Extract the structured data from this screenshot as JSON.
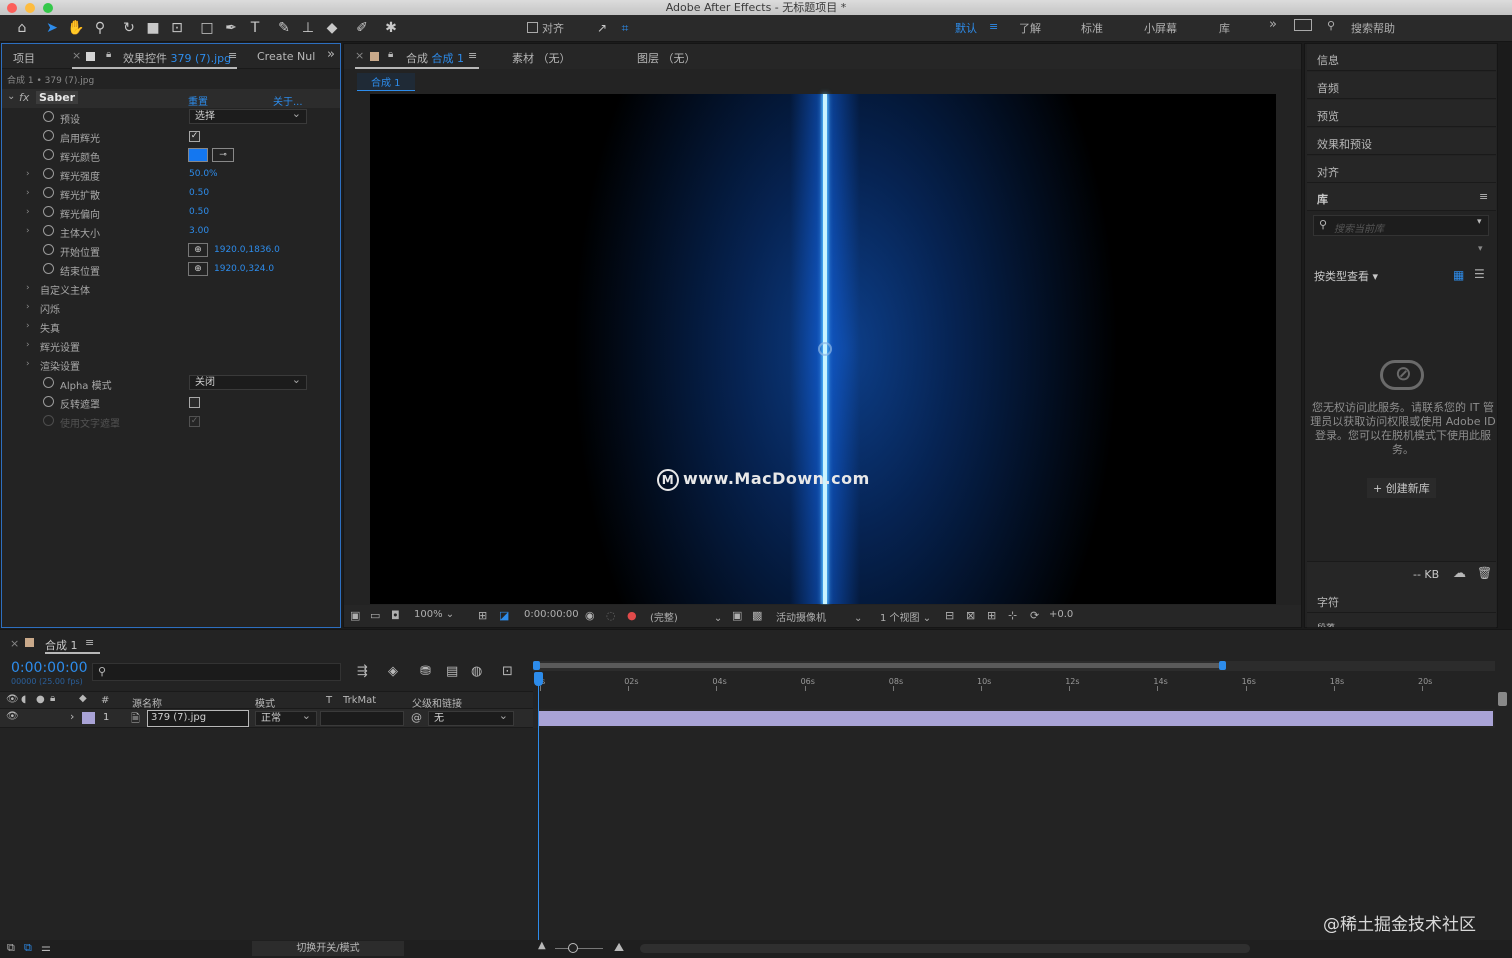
{
  "app": {
    "window_title": "Adobe After Effects - 无标题项目 *"
  },
  "toolbar": {
    "snap_label": "对齐",
    "workspaces": [
      "默认",
      "了解",
      "标准",
      "小屏幕",
      "库"
    ],
    "active_workspace": "默认",
    "search_help_placeholder": "搜索帮助",
    "more": "»"
  },
  "left_panel": {
    "tab_project": "项目",
    "tab_effects_prefix": "效果控件",
    "tab_effects_file": "379 (7).jpg",
    "tab_create": "Create Nul",
    "breadcrumb": "合成 1 • 379 (7).jpg",
    "effect_name": "Saber",
    "reset": "重置",
    "about": "关于...",
    "properties": [
      {
        "name": "预设",
        "kind": "select",
        "value": "选择"
      },
      {
        "name": "启用辉光",
        "kind": "checkbox",
        "checked": true
      },
      {
        "name": "辉光颜色",
        "kind": "color",
        "color": "#1477f0"
      },
      {
        "name": "辉光强度",
        "kind": "value",
        "value": "50.0%",
        "expand": true
      },
      {
        "name": "辉光扩散",
        "kind": "value",
        "value": "0.50",
        "expand": true
      },
      {
        "name": "辉光偏向",
        "kind": "value",
        "value": "0.50",
        "expand": true
      },
      {
        "name": "主体大小",
        "kind": "value",
        "value": "3.00",
        "expand": true
      },
      {
        "name": "开始位置",
        "kind": "point",
        "value": "1920.0,1836.0"
      },
      {
        "name": "结束位置",
        "kind": "point",
        "value": "1920.0,324.0"
      },
      {
        "name": "自定义主体",
        "kind": "group"
      },
      {
        "name": "闪烁",
        "kind": "group"
      },
      {
        "name": "失真",
        "kind": "group"
      },
      {
        "name": "辉光设置",
        "kind": "group"
      },
      {
        "name": "渲染设置",
        "kind": "group"
      },
      {
        "name": "Alpha 模式",
        "kind": "select",
        "value": "关闭"
      },
      {
        "name": "反转遮罩",
        "kind": "checkbox",
        "checked": false
      },
      {
        "name": "使用文字遮罩",
        "kind": "checkbox",
        "checked": true,
        "disabled": true
      }
    ]
  },
  "comp_panel": {
    "tab_prefix": "合成",
    "tab_comp": "合成 1",
    "tab_footage": "素材 （无）",
    "tab_layer": "图层 （无）",
    "sub_tab": "合成 1",
    "watermark": "www.MacDown.com",
    "bottom": {
      "zoom": "100%",
      "timecode": "0:00:00:00",
      "resolution": "(完整)",
      "camera": "活动摄像机",
      "views": "1 个视图",
      "exposure": "+0.0"
    }
  },
  "right_panel": {
    "items": [
      "信息",
      "音频",
      "预览",
      "效果和预设",
      "对齐"
    ],
    "library_title": "库",
    "library_search_placeholder": "搜索当前库",
    "view_by": "按类型查看",
    "message": "您无权访问此服务。请联系您的 IT 管理员以获取访问权限或使用 Adobe ID 登录。您可以在脱机模式下使用此服务。",
    "create_library": "+ 创建新库",
    "kb": "-- KB",
    "char": "字符",
    "para": "段落"
  },
  "timeline": {
    "tab": "合成 1",
    "timecode": "0:00:00:00",
    "fps_info": "00000 (25.00 fps)",
    "columns": {
      "num": "#",
      "source": "源名称",
      "mode": "模式",
      "t": "T",
      "trkmat": "TrkMat",
      "parent": "父级和链接"
    },
    "layer": {
      "index": "1",
      "name": "379 (7).jpg",
      "mode": "正常",
      "parent": "无"
    },
    "ruler": [
      "0s",
      "02s",
      "04s",
      "06s",
      "08s",
      "10s",
      "12s",
      "14s",
      "16s",
      "18s",
      "20s"
    ],
    "toggle_label": "切换开关/模式"
  },
  "footer_watermark": "@稀土掘金技术社区"
}
